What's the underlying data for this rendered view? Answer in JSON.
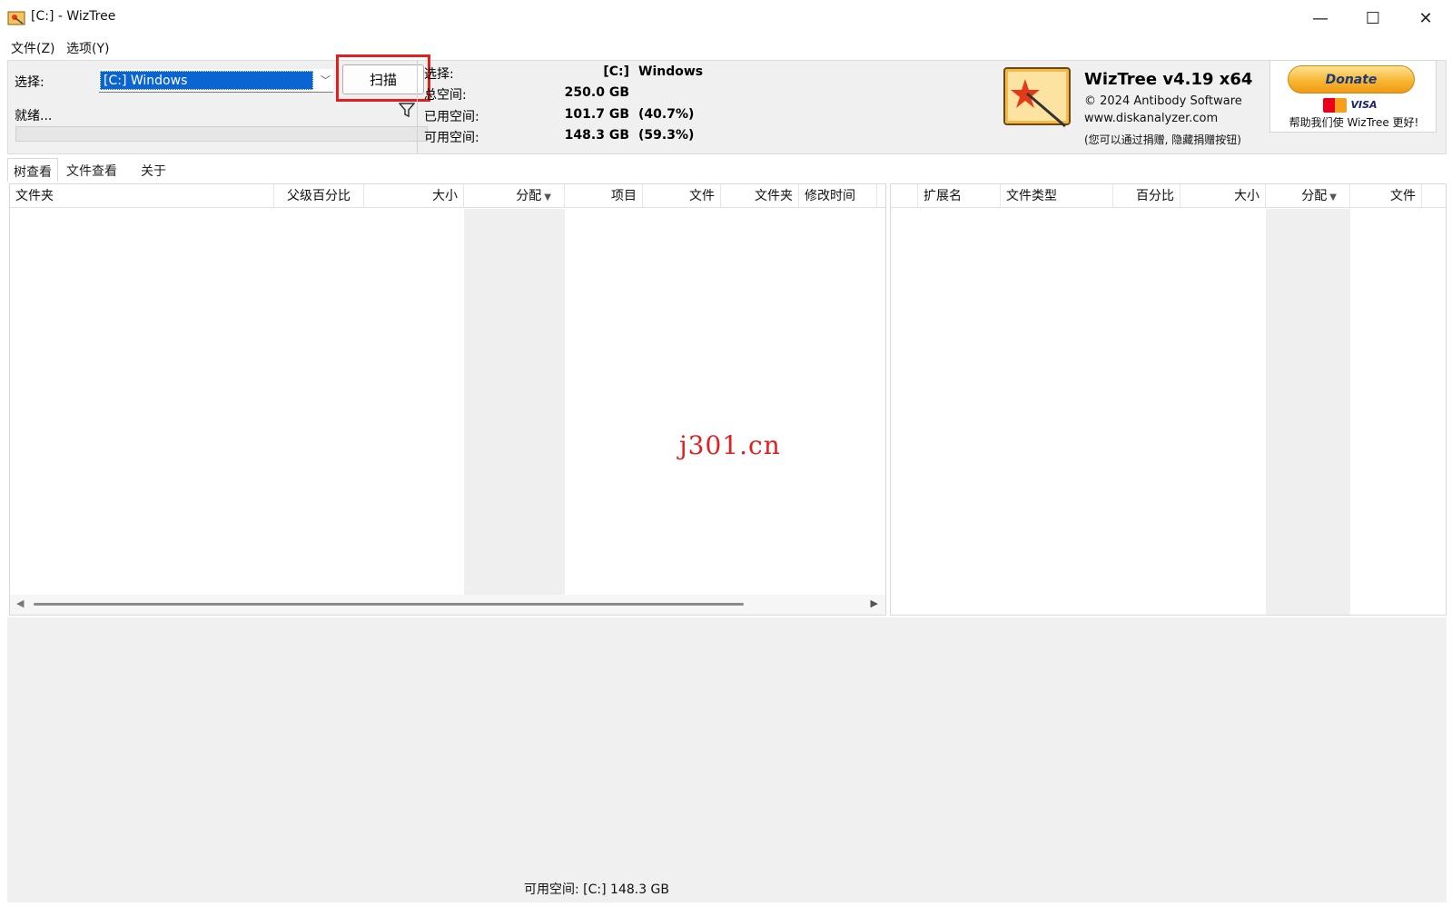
{
  "window": {
    "title": "[C:]  - WizTree",
    "minimize_glyph": "—",
    "maximize_glyph": "☐",
    "close_glyph": "✕"
  },
  "menu": {
    "file": "文件(Z)",
    "options": "选项(Y)"
  },
  "scan_panel": {
    "select_label": "选择:",
    "drive_value": "[C:] Windows",
    "scan_button": "扫描",
    "ready_label": "就绪..."
  },
  "drive_info": {
    "select_label": "选择:",
    "drive": "[C:]",
    "drive_name": "Windows",
    "total_label": "总空间:",
    "total_value": "250.0 GB",
    "used_label": "已用空间:",
    "used_value": "101.7 GB",
    "used_pct": "(40.7%)",
    "free_label": "可用空间:",
    "free_value": "148.3 GB",
    "free_pct": "(59.3%)"
  },
  "about": {
    "product": "WizTree v4.19 x64",
    "copyright": "© 2024 Antibody Software",
    "website": "www.diskanalyzer.com",
    "hint": "(您可以通过捐赠, 隐藏捐赠按钮)"
  },
  "donate": {
    "button": "Donate",
    "card_visa": "VISA",
    "text": "帮助我们使 WizTree 更好!"
  },
  "tabs": [
    {
      "label": "树查看",
      "active": true
    },
    {
      "label": "文件查看",
      "active": false
    },
    {
      "label": "关于",
      "active": false
    }
  ],
  "tree_columns": {
    "folder": "文件夹",
    "parent_pct": "父级百分比",
    "size": "大小",
    "allocated": "分配",
    "items": "项目",
    "files": "文件",
    "folders": "文件夹",
    "modified": "修改时间"
  },
  "ext_columns": {
    "extension": "扩展名",
    "file_type": "文件类型",
    "percent": "百分比",
    "size": "大小",
    "allocated": "分配",
    "files": "文件"
  },
  "status_bar": {
    "free_space": "可用空间: [C:] 148.3 GB"
  },
  "watermark": "j301.cn",
  "colors": {
    "selection_blue": "#0a64d2",
    "highlight_red": "#e02020",
    "panel_gray": "#f0f0f0"
  }
}
